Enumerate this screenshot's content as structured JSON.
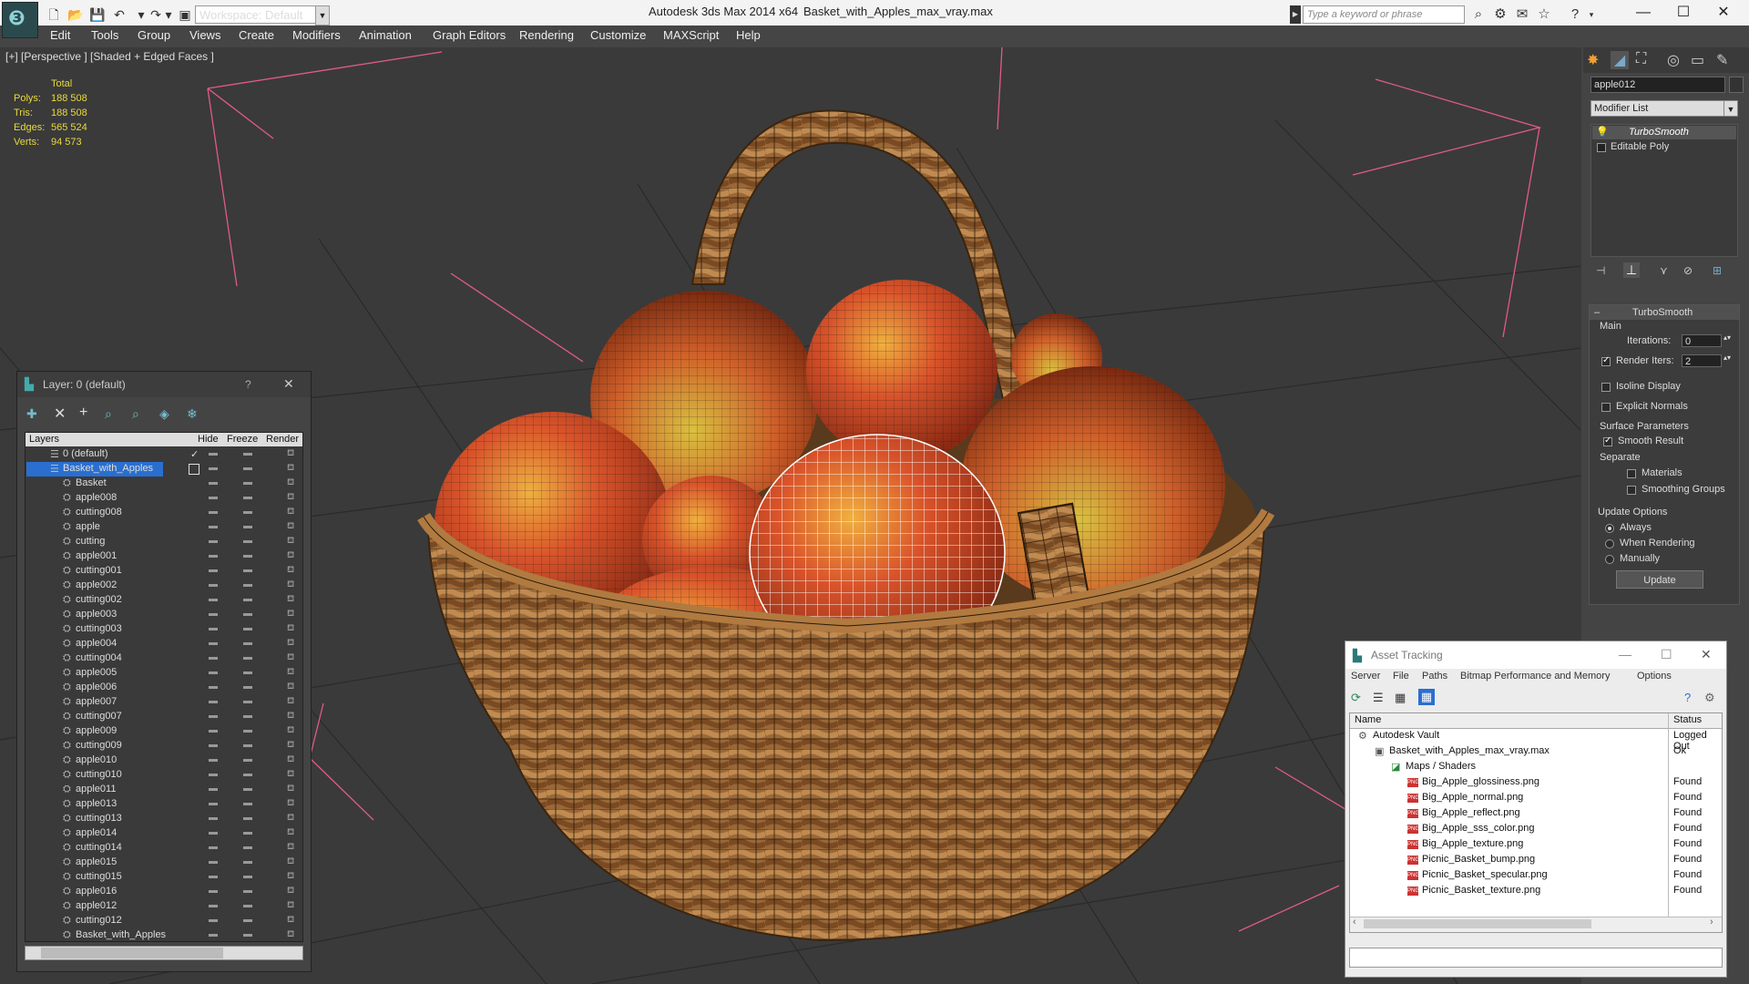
{
  "titlebar": {
    "app_title": "Autodesk 3ds Max  2014 x64",
    "file_title": "Basket_with_Apples_max_vray.max",
    "workspace": "Workspace: Default",
    "keyword_placeholder": "Type a keyword or phrase"
  },
  "menu": [
    "Edit",
    "Tools",
    "Group",
    "Views",
    "Create",
    "Modifiers",
    "Animation",
    "Graph Editors",
    "Rendering",
    "Customize",
    "MAXScript",
    "Help"
  ],
  "viewport": {
    "label": "[+] [Perspective ] [Shaded + Edged Faces ]",
    "stats": {
      "header": "Total",
      "rows": [
        {
          "label": "Polys:",
          "value": "188 508"
        },
        {
          "label": "Tris:",
          "value": "188 508"
        },
        {
          "label": "Edges:",
          "value": "565 524"
        },
        {
          "label": "Verts:",
          "value": "94 573"
        }
      ]
    }
  },
  "command_panel": {
    "object_name": "apple012",
    "modifier_list": "Modifier List",
    "stack": [
      "TurboSmooth",
      "Editable Poly"
    ],
    "rollout_title": "TurboSmooth",
    "main_label": "Main",
    "iterations_label": "Iterations:",
    "iterations_value": "0",
    "render_iters_label": "Render Iters:",
    "render_iters_value": "2",
    "isoline_display": "Isoline Display",
    "explicit_normals": "Explicit Normals",
    "surface_params": "Surface Parameters",
    "smooth_result": "Smooth Result",
    "separate": "Separate",
    "materials": "Materials",
    "smoothing_groups": "Smoothing Groups",
    "update_options": "Update Options",
    "always": "Always",
    "when_rendering": "When Rendering",
    "manually": "Manually",
    "update_button": "Update"
  },
  "layer_window": {
    "title": "Layer: 0 (default)",
    "help": "?",
    "columns": [
      "Layers",
      "Hide",
      "Freeze",
      "Render"
    ],
    "root_layers": [
      "0 (default)",
      "Basket_with_Apples"
    ],
    "objects": [
      "Basket",
      "apple008",
      "cutting008",
      "apple",
      "cutting",
      "apple001",
      "cutting001",
      "apple002",
      "cutting002",
      "apple003",
      "cutting003",
      "apple004",
      "cutting004",
      "apple005",
      "apple006",
      "apple007",
      "cutting007",
      "apple009",
      "cutting009",
      "apple010",
      "cutting010",
      "apple011",
      "apple013",
      "cutting013",
      "apple014",
      "cutting014",
      "apple015",
      "cutting015",
      "apple016",
      "apple012",
      "cutting012",
      "Basket_with_Apples"
    ]
  },
  "asset_tracking": {
    "title": "Asset Tracking",
    "menu": [
      "Server",
      "File",
      "Paths",
      "Bitmap Performance and Memory",
      "Options"
    ],
    "columns": [
      "Name",
      "Status"
    ],
    "rows": [
      {
        "name": "Autodesk Vault",
        "status": "Logged Out",
        "level": 0
      },
      {
        "name": "Basket_with_Apples_max_vray.max",
        "status": "Ok",
        "level": 1
      },
      {
        "name": "Maps / Shaders",
        "status": "",
        "level": 2
      },
      {
        "name": "Big_Apple_glossiness.png",
        "status": "Found",
        "level": 3
      },
      {
        "name": "Big_Apple_normal.png",
        "status": "Found",
        "level": 3
      },
      {
        "name": "Big_Apple_reflect.png",
        "status": "Found",
        "level": 3
      },
      {
        "name": "Big_Apple_sss_color.png",
        "status": "Found",
        "level": 3
      },
      {
        "name": "Big_Apple_texture.png",
        "status": "Found",
        "level": 3
      },
      {
        "name": "Picnic_Basket_bump.png",
        "status": "Found",
        "level": 3
      },
      {
        "name": "Picnic_Basket_specular.png",
        "status": "Found",
        "level": 3
      },
      {
        "name": "Picnic_Basket_texture.png",
        "status": "Found",
        "level": 3
      }
    ]
  },
  "colors": {
    "viewport_bg": "#3a3a3a",
    "stats_yellow": "#e8d93c",
    "selection_blue": "#2a6fd0",
    "light_pink": "#e05a8a"
  }
}
